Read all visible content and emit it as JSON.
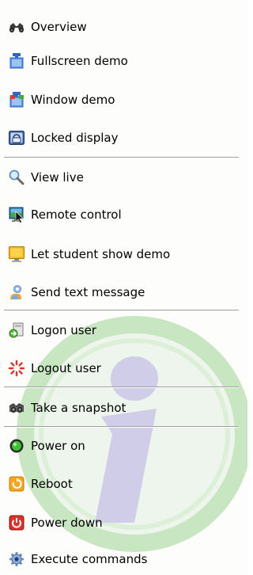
{
  "menu": {
    "groups": [
      {
        "items": [
          {
            "label": "Overview",
            "icon": "binoculars-icon"
          },
          {
            "label": "Fullscreen demo",
            "icon": "fullscreen-demo-icon"
          },
          {
            "label": "Window demo",
            "icon": "window-demo-icon"
          },
          {
            "label": "Locked display",
            "icon": "locked-display-icon"
          }
        ]
      },
      {
        "items": [
          {
            "label": "View live",
            "icon": "magnifier-icon"
          },
          {
            "label": "Remote control",
            "icon": "remote-control-icon"
          },
          {
            "label": "Let student show demo",
            "icon": "student-demo-icon"
          },
          {
            "label": "Send text message",
            "icon": "send-message-icon"
          }
        ]
      },
      {
        "items": [
          {
            "label": "Logon user",
            "icon": "logon-user-icon"
          },
          {
            "label": "Logout user",
            "icon": "logout-user-icon"
          }
        ]
      },
      {
        "items": [
          {
            "label": "Take a snapshot",
            "icon": "camera-icon"
          }
        ]
      },
      {
        "items": [
          {
            "label": "Power on",
            "icon": "power-on-icon"
          },
          {
            "label": "Reboot",
            "icon": "reboot-icon"
          },
          {
            "label": "Power down",
            "icon": "power-down-icon"
          },
          {
            "label": "Execute commands",
            "icon": "execute-commands-icon"
          }
        ]
      }
    ]
  },
  "colors": {
    "background": "#fdfdfb",
    "separator": "#a0a0a0",
    "watermark_ring": "#c9e6c2",
    "watermark_fill": "#eef5ec",
    "watermark_letter": "#cfcde8"
  },
  "watermark": {
    "icon": "info-watermark-icon"
  }
}
